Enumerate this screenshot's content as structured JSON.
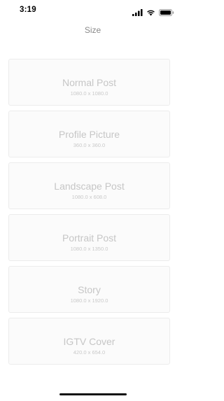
{
  "status_bar": {
    "time": "3:19",
    "icons": [
      "signal-icon",
      "wifi-icon",
      "battery-icon"
    ]
  },
  "nav": {
    "title": "Size"
  },
  "options": [
    {
      "title": "Normal Post",
      "size": "1080.0 x 1080.0"
    },
    {
      "title": "Profile Picture",
      "size": "360.0 x 360.0"
    },
    {
      "title": "Landscape Post",
      "size": "1080.0 x 608.0"
    },
    {
      "title": "Portrait Post",
      "size": "1080.0 x 1350.0"
    },
    {
      "title": "Story",
      "size": "1080.0 x 1920.0"
    },
    {
      "title": "IGTV Cover",
      "size": "420.0 x 654.0"
    }
  ],
  "colors": {
    "card_background": "#fbfbfb",
    "card_border": "#ececec",
    "card_text": "#c6c6c6",
    "nav_title": "#8a8a8a"
  }
}
